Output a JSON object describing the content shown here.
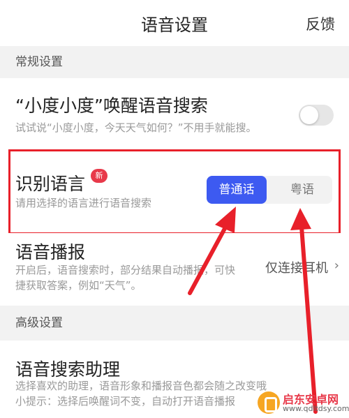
{
  "header": {
    "title": "语音设置",
    "feedback_label": "反馈"
  },
  "sections": {
    "general": "常规设置",
    "advanced": "高级设置"
  },
  "wake": {
    "title": "“小度小度”唤醒语音搜索",
    "desc": "试试说“小度小度，今天天气如何？”不用手就能搜。",
    "enabled": false
  },
  "language": {
    "title": "识别语言",
    "badge": "新",
    "desc": "请用选择的语言进行语音搜索",
    "options": [
      "普通话",
      "粤语"
    ],
    "selected": "普通话"
  },
  "broadcast": {
    "title": "语音播报",
    "desc": "开启后，语音搜索时，部分结果自动播报，可快捷获取答案，例如“天气”。",
    "value": "仅连接耳机"
  },
  "assistant": {
    "title": "语音搜索助理",
    "desc": "选择喜欢的助理，语音形象和播报音色都会随之改变哦\n小提示：选择后唤醒词不变，自动打开语音播报"
  },
  "watermark": {
    "name": "启东安卓网",
    "url": "www.qdltdsy.com"
  },
  "colors": {
    "accent": "#3d5af1",
    "highlight": "#e8202a",
    "badge": "#e8394a"
  }
}
